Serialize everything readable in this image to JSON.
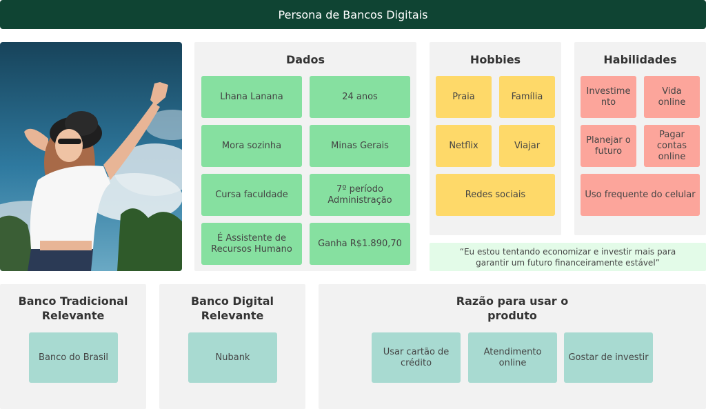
{
  "header": {
    "title": "Persona de Bancos Digitais"
  },
  "photo": {
    "subject": "woman-arms-raised-photo"
  },
  "dados": {
    "title": "Dados",
    "items": [
      "Lhana Lanana",
      "24 anos",
      "Mora sozinha",
      "Minas Gerais",
      "Cursa faculdade",
      "7º período Administração",
      "É Assistente de Recursos Humano",
      "Ganha R$1.890,70"
    ]
  },
  "hobbies": {
    "title": "Hobbies",
    "items": [
      "Praia",
      "Família",
      "Netflix",
      "Viajar",
      "Redes sociais"
    ]
  },
  "habilidades": {
    "title": "Habilidades",
    "items": [
      "Investime nto",
      "Vida online",
      "Planejar o futuro",
      "Pagar contas online",
      "Uso frequente do celular"
    ]
  },
  "quote": {
    "text": "“Eu estou tentando economizar e investir mais para\ngarantir um futuro financeiramente estável”"
  },
  "banco_tradicional": {
    "title": "Banco Tradicional Relevante",
    "item": "Banco do Brasil"
  },
  "banco_digital": {
    "title": "Banco Digital Relevante",
    "item": "Nubank"
  },
  "razao": {
    "title": "Razão para usar o produto",
    "items": [
      "Usar cartão de crédito",
      "Atendimento online",
      "Gostar de investir"
    ]
  },
  "colors": {
    "header": "#0f4433",
    "panel": "#f2f2f2",
    "green": "#86e0a0",
    "yellow": "#fed969",
    "red": "#fca59b",
    "teal": "#a8dad1",
    "quote_bg": "#e3fbe8"
  }
}
